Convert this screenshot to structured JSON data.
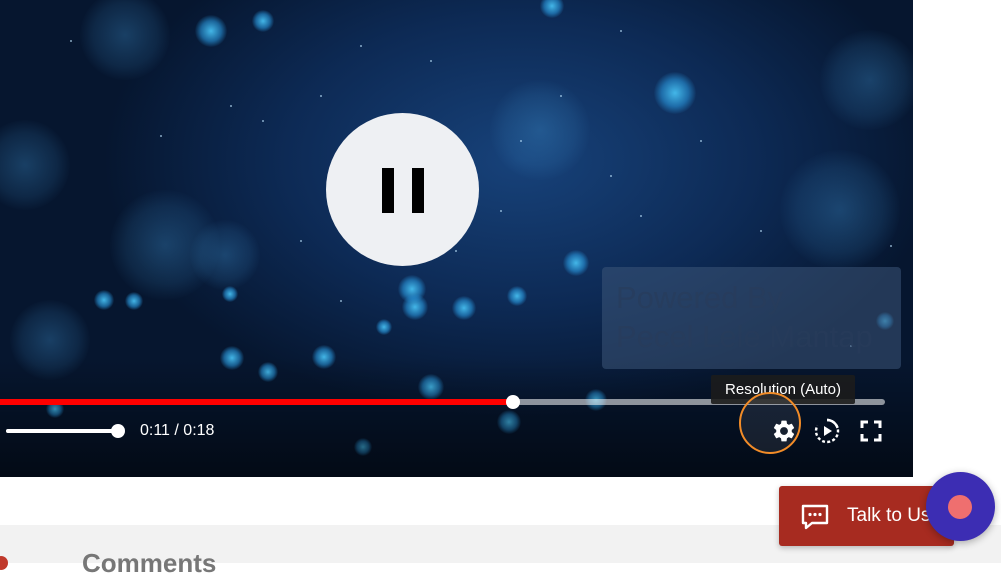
{
  "player": {
    "watermark_line1": "Powered By",
    "watermark_line2": "Pecel Lele Mantap",
    "progress_fraction": 0.58,
    "volume_fraction": 1.0,
    "time_display": "0:11 / 0:18",
    "tooltip": "Resolution (Auto)",
    "colors": {
      "played": "#ff0000",
      "settings_highlight": "#f28c28"
    }
  },
  "icons": {
    "pause": "pause-icon",
    "settings": "gear-icon",
    "autoplay": "play-circle-icon",
    "fullscreen": "fullscreen-icon",
    "chat": "chat-bubble-icon"
  },
  "chat_widget": {
    "button_label": "Talk to Us",
    "colors": {
      "button": "#a72b20",
      "fab": "#3c2db3",
      "fab_dot": "#ef6f6f"
    }
  },
  "comments": {
    "title": "Comments"
  }
}
